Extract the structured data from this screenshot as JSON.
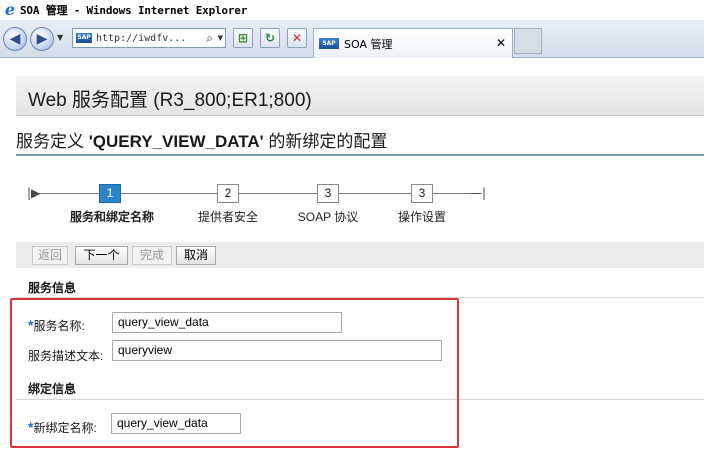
{
  "window": {
    "title": "SOA 管理 - Windows Internet Explorer",
    "ie_logo": "e"
  },
  "browser": {
    "address": "http://iwdfv...",
    "tab_label": "SOA 管理",
    "tab_close": "✕",
    "sap_badge": "SAP",
    "icons": {
      "back": "back-arrow-icon",
      "forward": "forward-arrow-icon",
      "search": "search-icon",
      "compat": "compatibility-view-icon",
      "refresh": "refresh-icon",
      "stop": "stop-icon"
    }
  },
  "page": {
    "title": "Web 服务配置 (R3_800;ER1;800)",
    "subtitle_prefix": "服务定义 ",
    "subtitle_name": "'QUERY_VIEW_DATA'",
    "subtitle_suffix": " 的新绑定的配置"
  },
  "roadmap": {
    "steps": [
      {
        "number": "1",
        "label": "服务和绑定名称",
        "active": true
      },
      {
        "number": "2",
        "label": "提供者安全",
        "active": false
      },
      {
        "number": "3",
        "label": "SOAP 协议",
        "active": false
      },
      {
        "number": "3",
        "label": "操作设置",
        "active": false
      }
    ]
  },
  "buttons": {
    "back": "返回",
    "next": "下一个",
    "finish": "完成",
    "cancel": "取消"
  },
  "service_info": {
    "title": "服务信息",
    "name_label": "服务名称:",
    "name_value": "query_view_data",
    "desc_label": "服务描述文本:",
    "desc_value": "queryview"
  },
  "binding_info": {
    "title": "绑定信息",
    "binding_label": "新绑定名称:",
    "binding_value": "query_view_data"
  },
  "required_marker": "*",
  "colors": {
    "accent": "#2d84c9",
    "highlight": "#d9363b",
    "required": "#1f6fc5"
  }
}
